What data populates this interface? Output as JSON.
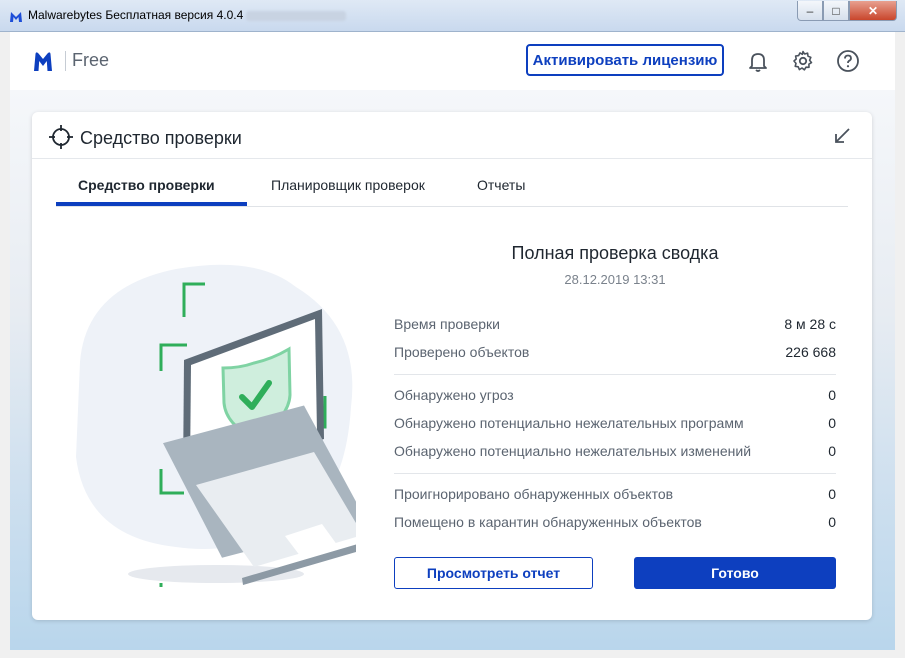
{
  "window": {
    "title": "Malwarebytes Бесплатная версия  4.0.4",
    "controls": [
      "minimize-icon",
      "maximize-icon",
      "close-icon"
    ]
  },
  "header": {
    "brand": "Free",
    "activate_label": "Активировать лицензию",
    "icons": [
      "bell-icon",
      "gear-icon",
      "help-icon"
    ]
  },
  "colors": {
    "accent": "#0d3fbf",
    "shield_green": "#2fae5a"
  },
  "card": {
    "title": "Средство проверки",
    "tabs": [
      {
        "label": "Средство проверки",
        "active": true
      },
      {
        "label": "Планировщик проверок",
        "active": false
      },
      {
        "label": "Отчеты",
        "active": false
      }
    ]
  },
  "summary": {
    "title": "Полная проверка сводка",
    "date": "28.12.2019 13:31",
    "stats": [
      {
        "label": "Время проверки",
        "value": "8 м 28 с"
      },
      {
        "label": "Проверено объектов",
        "value": "226 668"
      },
      {
        "label": "Обнаружено угроз",
        "value": "0"
      },
      {
        "label": "Обнаружено потенциально нежелательных программ",
        "value": "0"
      },
      {
        "label": "Обнаружено потенциально нежелательных изменений",
        "value": "0"
      },
      {
        "label": "Проигнорировано обнаруженных объектов",
        "value": "0"
      },
      {
        "label": "Помещено в карантин обнаруженных объектов",
        "value": "0"
      }
    ],
    "view_report_label": "Просмотреть отчет",
    "done_label": "Готово"
  }
}
